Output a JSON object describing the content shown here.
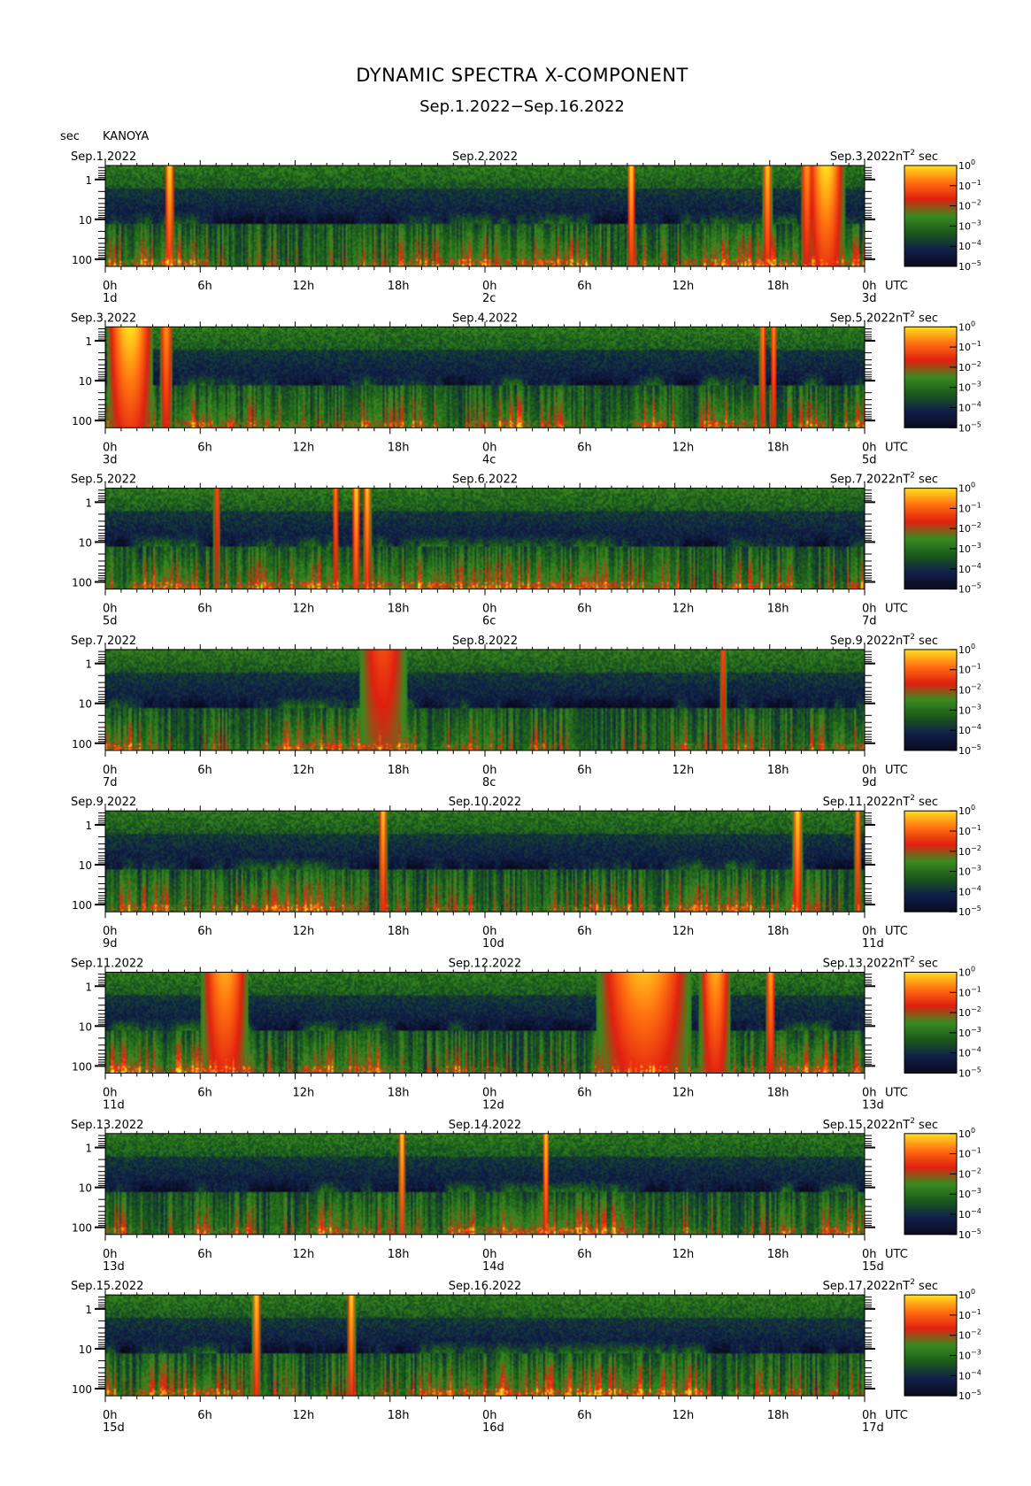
{
  "title": "DYNAMIC SPECTRA X-COMPONENT",
  "subtitle": "Sep.1.2022−Sep.16.2022",
  "ylabel": "sec",
  "station": "KANOYA",
  "colorbar": {
    "unit_label": "nT",
    "unit_exp": "2",
    "unit_sec": "sec",
    "ticks": [
      {
        "base": "10",
        "exp": "0"
      },
      {
        "base": "10",
        "exp": "−1"
      },
      {
        "base": "10",
        "exp": "−2"
      },
      {
        "base": "10",
        "exp": "−3"
      },
      {
        "base": "10",
        "exp": "−4"
      },
      {
        "base": "10",
        "exp": "−5"
      }
    ],
    "colors": [
      "#0a0a1e",
      "#10204a",
      "#1a5a1a",
      "#3a8a20",
      "#e02010",
      "#ff7010",
      "#ffe020"
    ]
  },
  "time_ticks": [
    "0h",
    "6h",
    "12h",
    "18h",
    "0h",
    "6h",
    "12h",
    "18h",
    "0h"
  ],
  "utc_label": "UTC",
  "chart_data": {
    "type": "heatmap",
    "x_unit": "hours UTC",
    "y_unit": "sec (period, log scale)",
    "y_ticks": [
      "1",
      "10",
      "100"
    ],
    "y_scale": "log",
    "color_scale": "log",
    "color_range": [
      "10^-5",
      "10^0"
    ],
    "panels": [
      {
        "left": "Sep.1.2022",
        "mid": "Sep.2.2022",
        "right": "Sep.3.2022",
        "d1": "1d",
        "d2": "2c",
        "d3": "3d",
        "bursts": [
          {
            "hour": 4,
            "width": 0.3,
            "level": 1.0
          },
          {
            "hour": 33.2,
            "width": 0.25,
            "level": 1.0
          },
          {
            "hour": 41.8,
            "width": 0.3,
            "level": 0.95
          },
          {
            "hour": 45.5,
            "width": 1.2,
            "level": 1.0
          },
          {
            "hour": 44.3,
            "width": 0.4,
            "level": 0.8
          }
        ]
      },
      {
        "left": "Sep.3.2022",
        "mid": "Sep.4.2022",
        "right": "Sep.5.2022",
        "d1": "3d",
        "d2": "4c",
        "d3": "5d",
        "bursts": [
          {
            "hour": 1.5,
            "width": 1.5,
            "level": 1.0
          },
          {
            "hour": 3.8,
            "width": 0.4,
            "level": 0.8
          },
          {
            "hour": 41.5,
            "width": 0.2,
            "level": 0.8
          },
          {
            "hour": 42.2,
            "width": 0.2,
            "level": 0.8
          }
        ]
      },
      {
        "left": "Sep.5.2022",
        "mid": "Sep.6.2022",
        "right": "Sep.7.2022",
        "d1": "5d",
        "d2": "6c",
        "d3": "7d",
        "bursts": [
          {
            "hour": 14.5,
            "width": 0.2,
            "level": 0.75
          },
          {
            "hour": 15.8,
            "width": 0.25,
            "level": 1.0
          },
          {
            "hour": 16.5,
            "width": 0.25,
            "level": 0.95
          },
          {
            "hour": 7,
            "width": 0.2,
            "level": 0.6
          }
        ]
      },
      {
        "left": "Sep.7.2022",
        "mid": "Sep.8.2022",
        "right": "Sep.9.2022",
        "d1": "7d",
        "d2": "8c",
        "d3": "9d",
        "bursts": [
          {
            "hour": 17.5,
            "width": 1.5,
            "level": 0.55
          },
          {
            "hour": 39,
            "width": 0.2,
            "level": 0.6
          }
        ]
      },
      {
        "left": "Sep.9.2022",
        "mid": "Sep.10.2022",
        "right": "Sep.11.2022",
        "d1": "9d",
        "d2": "10d",
        "d3": "11d",
        "bursts": [
          {
            "hour": 17.5,
            "width": 0.25,
            "level": 0.95
          },
          {
            "hour": 43.7,
            "width": 0.3,
            "level": 1.0
          },
          {
            "hour": 47.5,
            "width": 0.2,
            "level": 0.85
          }
        ]
      },
      {
        "left": "Sep.11.2022",
        "mid": "Sep.12.2022",
        "right": "Sep.13.2022",
        "d1": "11d",
        "d2": "12d",
        "d3": "13d",
        "bursts": [
          {
            "hour": 7.5,
            "width": 1.5,
            "level": 0.85
          },
          {
            "hour": 34,
            "width": 3.0,
            "level": 0.9
          },
          {
            "hour": 38.5,
            "width": 1.0,
            "level": 0.85
          },
          {
            "hour": 42,
            "width": 0.3,
            "level": 0.85
          }
        ]
      },
      {
        "left": "Sep.13.2022",
        "mid": "Sep.14.2022",
        "right": "Sep.15.2022",
        "d1": "13d",
        "d2": "14d",
        "d3": "15d",
        "bursts": [
          {
            "hour": 18.7,
            "width": 0.2,
            "level": 1.0
          },
          {
            "hour": 27.8,
            "width": 0.2,
            "level": 1.0
          }
        ]
      },
      {
        "left": "Sep.15.2022",
        "mid": "Sep.16.2022",
        "right": "Sep.17.2022",
        "d1": "15d",
        "d2": "16d",
        "d3": "17d",
        "bursts": [
          {
            "hour": 9.5,
            "width": 0.25,
            "level": 1.0
          },
          {
            "hour": 15.5,
            "width": 0.25,
            "level": 1.0
          }
        ]
      }
    ]
  }
}
